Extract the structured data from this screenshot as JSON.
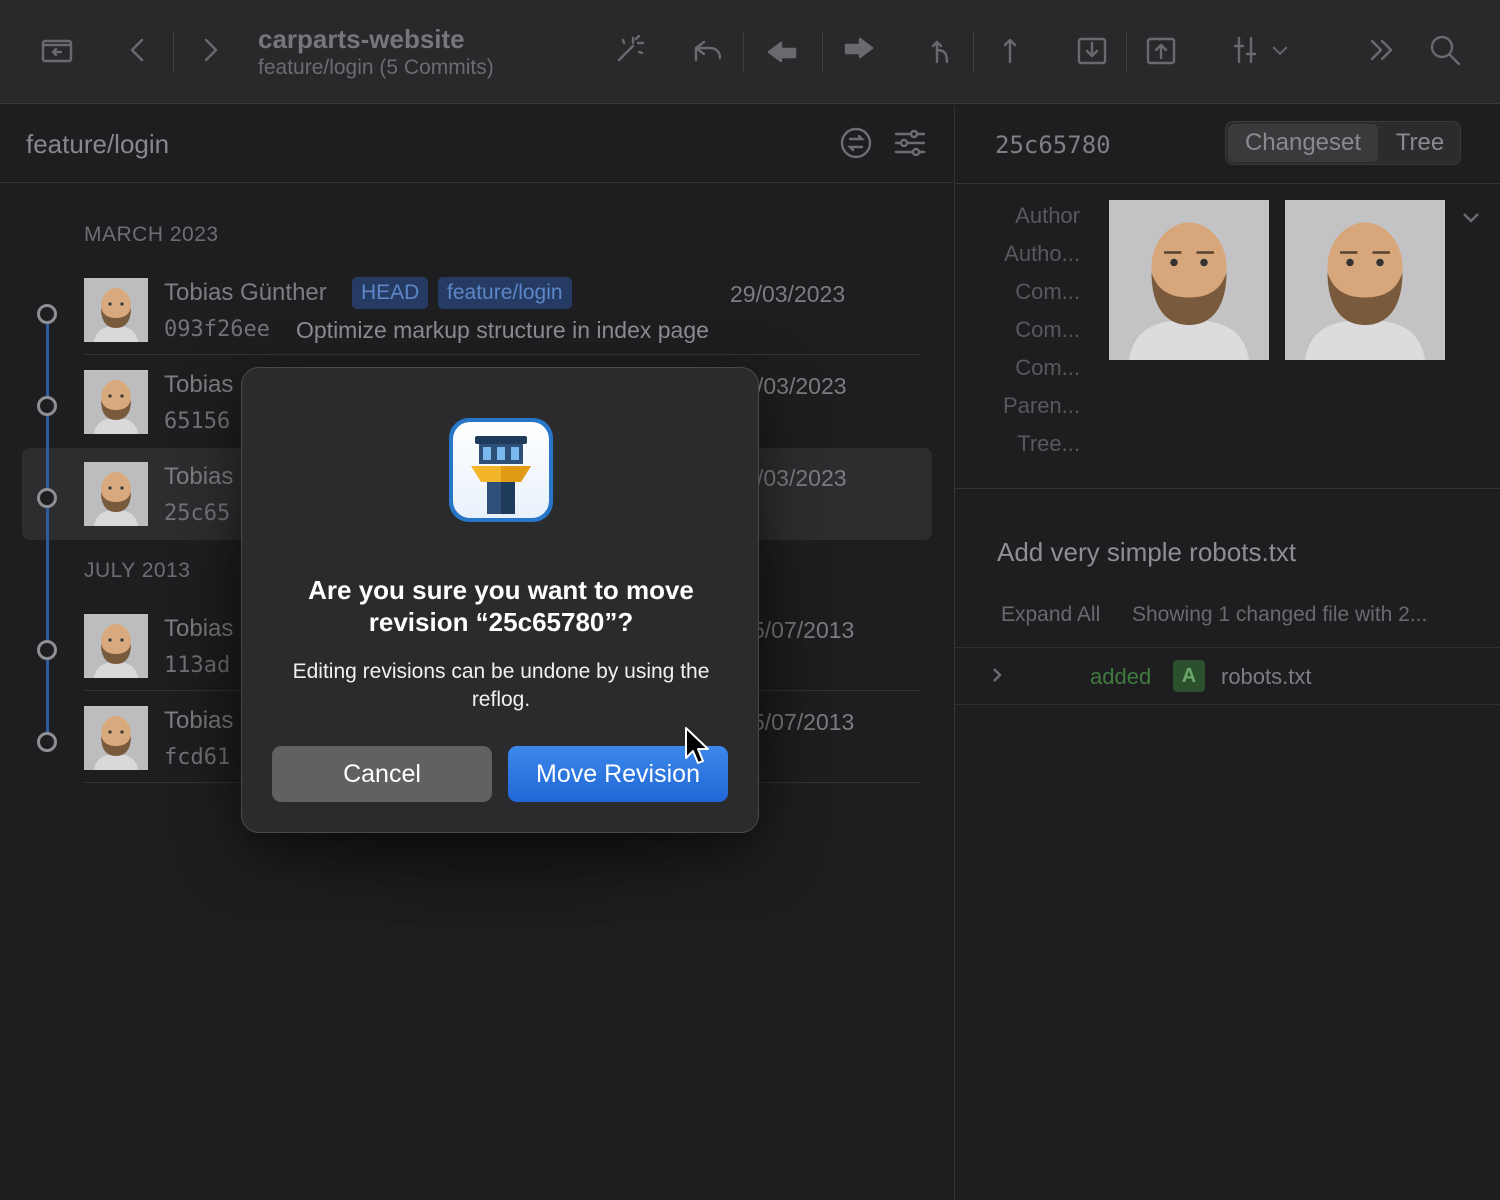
{
  "toolbar": {
    "repo_title": "carparts-website",
    "repo_subtitle": "feature/login (5 Commits)",
    "icons": [
      "sidebar-icon",
      "back-icon",
      "forward-icon",
      "magic-wand-icon",
      "undo-icon",
      "rewind-icon",
      "redo-icon",
      "merge-icon",
      "push-icon",
      "fetch-icon",
      "pull-icon",
      "filter-icon",
      "more-icon",
      "search-icon"
    ]
  },
  "left_pane": {
    "branch": "feature/login",
    "groups": [
      {
        "month": "MARCH 2023"
      },
      {
        "month": "JULY 2013"
      }
    ],
    "commits": [
      {
        "author": "Tobias Günther",
        "hash": "093f26ee",
        "message": "Optimize markup structure in index page",
        "date": "29/03/2023",
        "badges": [
          "HEAD",
          "feature/login"
        ]
      },
      {
        "author": "Tobias",
        "hash": "65156",
        "message": "",
        "date": "/03/2023"
      },
      {
        "author": "Tobias",
        "hash": "25c65",
        "message": "",
        "date": "/03/2023",
        "selected": true
      },
      {
        "author": "Tobias",
        "hash": "113ad",
        "message": "",
        "date": "5/07/2013"
      },
      {
        "author": "Tobias",
        "hash": "fcd61",
        "message": "",
        "date": "5/07/2013"
      }
    ]
  },
  "right_pane": {
    "hash": "25c65780",
    "tabs": {
      "changeset": "Changeset",
      "tree": "Tree"
    },
    "meta_labels": [
      "Author",
      "Autho...",
      "Com...",
      "Com...",
      "Com...",
      "Paren...",
      "Tree..."
    ],
    "subject": "Add very simple robots.txt",
    "expand_all": "Expand All",
    "showing": "Showing 1 changed file with 2...",
    "file": {
      "status": "added",
      "badge": "A",
      "name": "robots.txt"
    }
  },
  "modal": {
    "title": "Are you sure you want to move revision “25c65780”?",
    "body": "Editing revisions can be undone by using the reflog.",
    "cancel": "Cancel",
    "confirm": "Move Revision"
  },
  "colors": {
    "accent": "#2f7be0",
    "graph_line": "#2e5c9e",
    "badge_bg": "#263b63",
    "added": "#3f7a3f"
  }
}
